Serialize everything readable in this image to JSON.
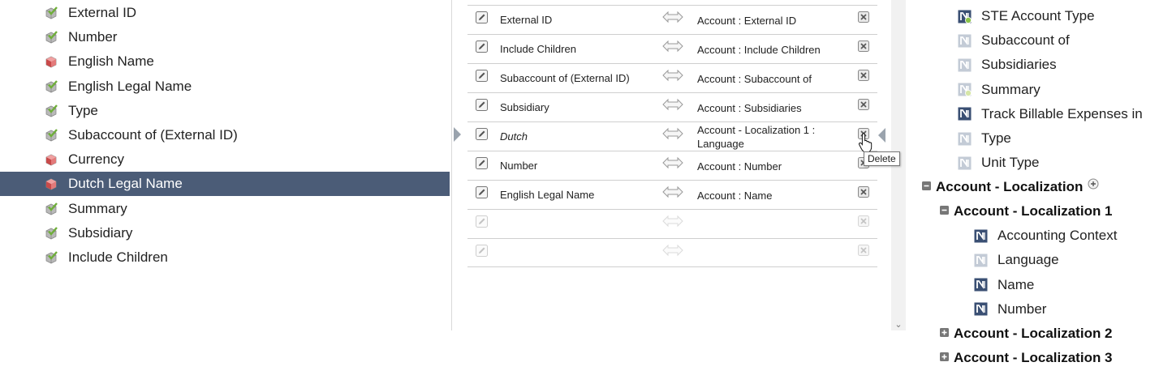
{
  "left_fields": [
    {
      "label": "External ID",
      "icon": "check-field-icon"
    },
    {
      "label": "Number",
      "icon": "check-field-icon"
    },
    {
      "label": "English Name",
      "icon": "required-field-icon"
    },
    {
      "label": "English Legal Name",
      "icon": "check-field-icon"
    },
    {
      "label": "Type",
      "icon": "check-field-icon"
    },
    {
      "label": "Subaccount of (External ID)",
      "icon": "check-field-icon"
    },
    {
      "label": "Currency",
      "icon": "required-field-icon"
    },
    {
      "label": "Dutch Legal Name",
      "icon": "required-field-icon",
      "selected": true
    },
    {
      "label": "Summary",
      "icon": "check-field-icon"
    },
    {
      "label": "Subsidiary",
      "icon": "check-field-icon"
    },
    {
      "label": "Include Children",
      "icon": "check-field-icon"
    }
  ],
  "mappings": [
    {
      "source": "External ID",
      "target": "Account : External ID"
    },
    {
      "source": "Include Children",
      "target": "Account : Include Children"
    },
    {
      "source": "Subaccount of (External ID)",
      "target": "Account : Subaccount of"
    },
    {
      "source": "Subsidiary",
      "target": "Account : Subsidiaries"
    },
    {
      "source": "Dutch",
      "target": "Account - Localization 1 : Language",
      "italic": true
    },
    {
      "source": "Number",
      "target": "Account : Number"
    },
    {
      "source": "English Legal Name",
      "target": "Account : Name"
    },
    {
      "source": "",
      "target": "",
      "empty": true
    },
    {
      "source": "",
      "target": "",
      "empty": true
    }
  ],
  "tooltip": "Delete",
  "scroll_down_glyph": "⌄",
  "right_tree": {
    "items": [
      {
        "label": "STE Account Type",
        "icon": "mapped-required-field-icon"
      },
      {
        "label": "Subaccount of",
        "icon": "unmapped-field-icon"
      },
      {
        "label": "Subsidiaries",
        "icon": "unmapped-field-icon"
      },
      {
        "label": "Summary",
        "icon": "unmapped-required-field-icon"
      },
      {
        "label": "Track Billable Expenses in",
        "icon": "mapped-field-icon"
      },
      {
        "label": "Type",
        "icon": "unmapped-field-icon"
      },
      {
        "label": "Unit Type",
        "icon": "unmapped-field-icon"
      }
    ],
    "group_localization": "Account - Localization",
    "group_localization_1": "Account - Localization 1",
    "localization_1_items": [
      {
        "label": "Accounting Context",
        "icon": "mapped-field-icon"
      },
      {
        "label": "Language",
        "icon": "unmapped-field-icon"
      },
      {
        "label": "Name",
        "icon": "mapped-field-icon"
      },
      {
        "label": "Number",
        "icon": "mapped-field-icon"
      }
    ],
    "group_localization_2": "Account - Localization 2",
    "group_localization_3": "Account - Localization 3"
  },
  "colors": {
    "selected_row": "#4b5c77",
    "mapped_icon": "#3a4f73",
    "unmapped_icon": "#c3cbd6",
    "check_green": "#6fae3a",
    "required_red": "#c94a4a"
  }
}
